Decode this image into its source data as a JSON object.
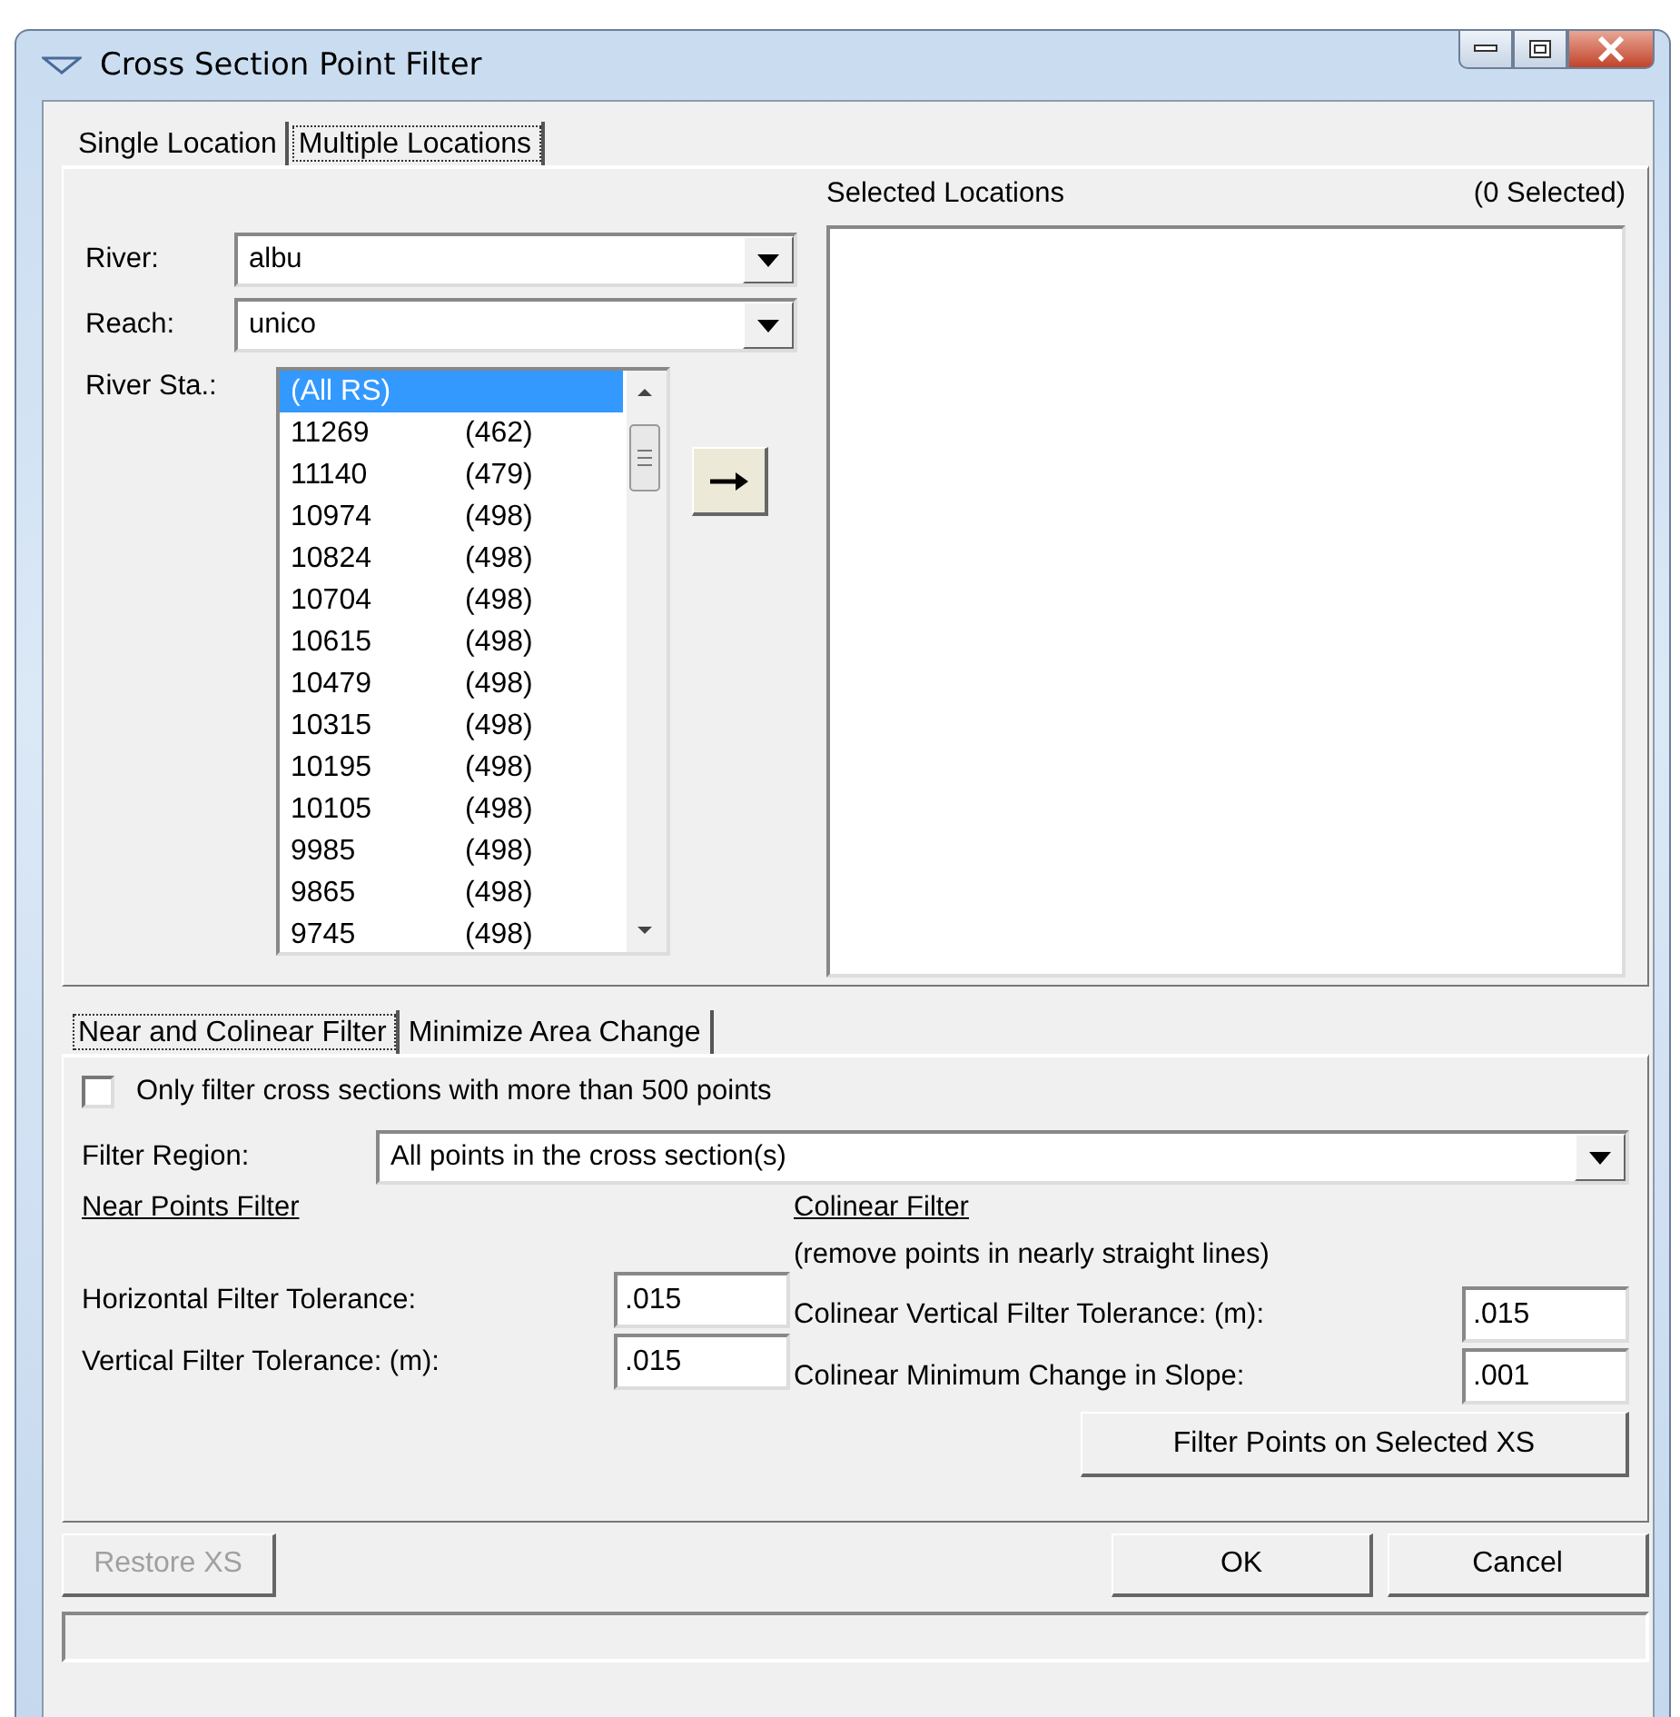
{
  "window": {
    "title": "Cross Section Point Filter"
  },
  "location_tabs": [
    {
      "label": "Single Location",
      "selected": false
    },
    {
      "label": "Multiple Locations",
      "selected": true
    }
  ],
  "river": {
    "label": "River:",
    "value": "albu"
  },
  "reach": {
    "label": "Reach:",
    "value": "unico"
  },
  "river_stations": {
    "label": "River Sta.:",
    "items": [
      {
        "station": "(All RS)",
        "selected": true
      },
      {
        "station": "11269",
        "points": "(462)",
        "selected": false
      },
      {
        "station": "11140",
        "points": "(479)",
        "selected": false
      },
      {
        "station": "10974",
        "points": "(498)",
        "selected": false
      },
      {
        "station": "10824",
        "points": "(498)",
        "selected": false
      },
      {
        "station": "10704",
        "points": "(498)",
        "selected": false
      },
      {
        "station": "10615",
        "points": "(498)",
        "selected": false
      },
      {
        "station": "10479",
        "points": "(498)",
        "selected": false
      },
      {
        "station": "10315",
        "points": "(498)",
        "selected": false
      },
      {
        "station": "10195",
        "points": "(498)",
        "selected": false
      },
      {
        "station": "10105",
        "points": "(498)",
        "selected": false
      },
      {
        "station": "9985",
        "points": "(498)",
        "selected": false
      },
      {
        "station": "9865",
        "points": "(498)",
        "selected": false
      },
      {
        "station": "9745",
        "points": "(498)",
        "selected": false
      }
    ]
  },
  "selected_locations": {
    "title": "Selected Locations",
    "count": "(0 Selected)"
  },
  "filter_tabs": [
    {
      "label": "Near and Colinear Filter",
      "selected": true
    },
    {
      "label": "Minimize Area Change",
      "selected": false
    }
  ],
  "only_large_option": {
    "label": "Only filter cross sections with more than 500 points",
    "checked": false
  },
  "filter_region": {
    "label": "Filter Region:",
    "value": "All points in the cross section(s)"
  },
  "near_points": {
    "heading": "Near Points Filter",
    "fields": [
      {
        "label": "Horizontal Filter Tolerance:",
        "value": ".015"
      },
      {
        "label": "Vertical Filter Tolerance: (m):",
        "value": ".015"
      }
    ]
  },
  "colinear": {
    "heading": "Colinear Filter",
    "note": "(remove points in nearly straight lines)",
    "fields": [
      {
        "label": "Colinear Vertical Filter Tolerance: (m):",
        "value": ".015"
      },
      {
        "label": "Colinear Minimum Change in Slope:",
        "value": ".001"
      }
    ]
  },
  "filter_button": "Filter Points on Selected XS",
  "buttons": [
    {
      "label": "Restore XS",
      "disabled": true
    },
    {
      "label": "OK",
      "disabled": false
    },
    {
      "label": "Cancel",
      "disabled": false
    }
  ]
}
